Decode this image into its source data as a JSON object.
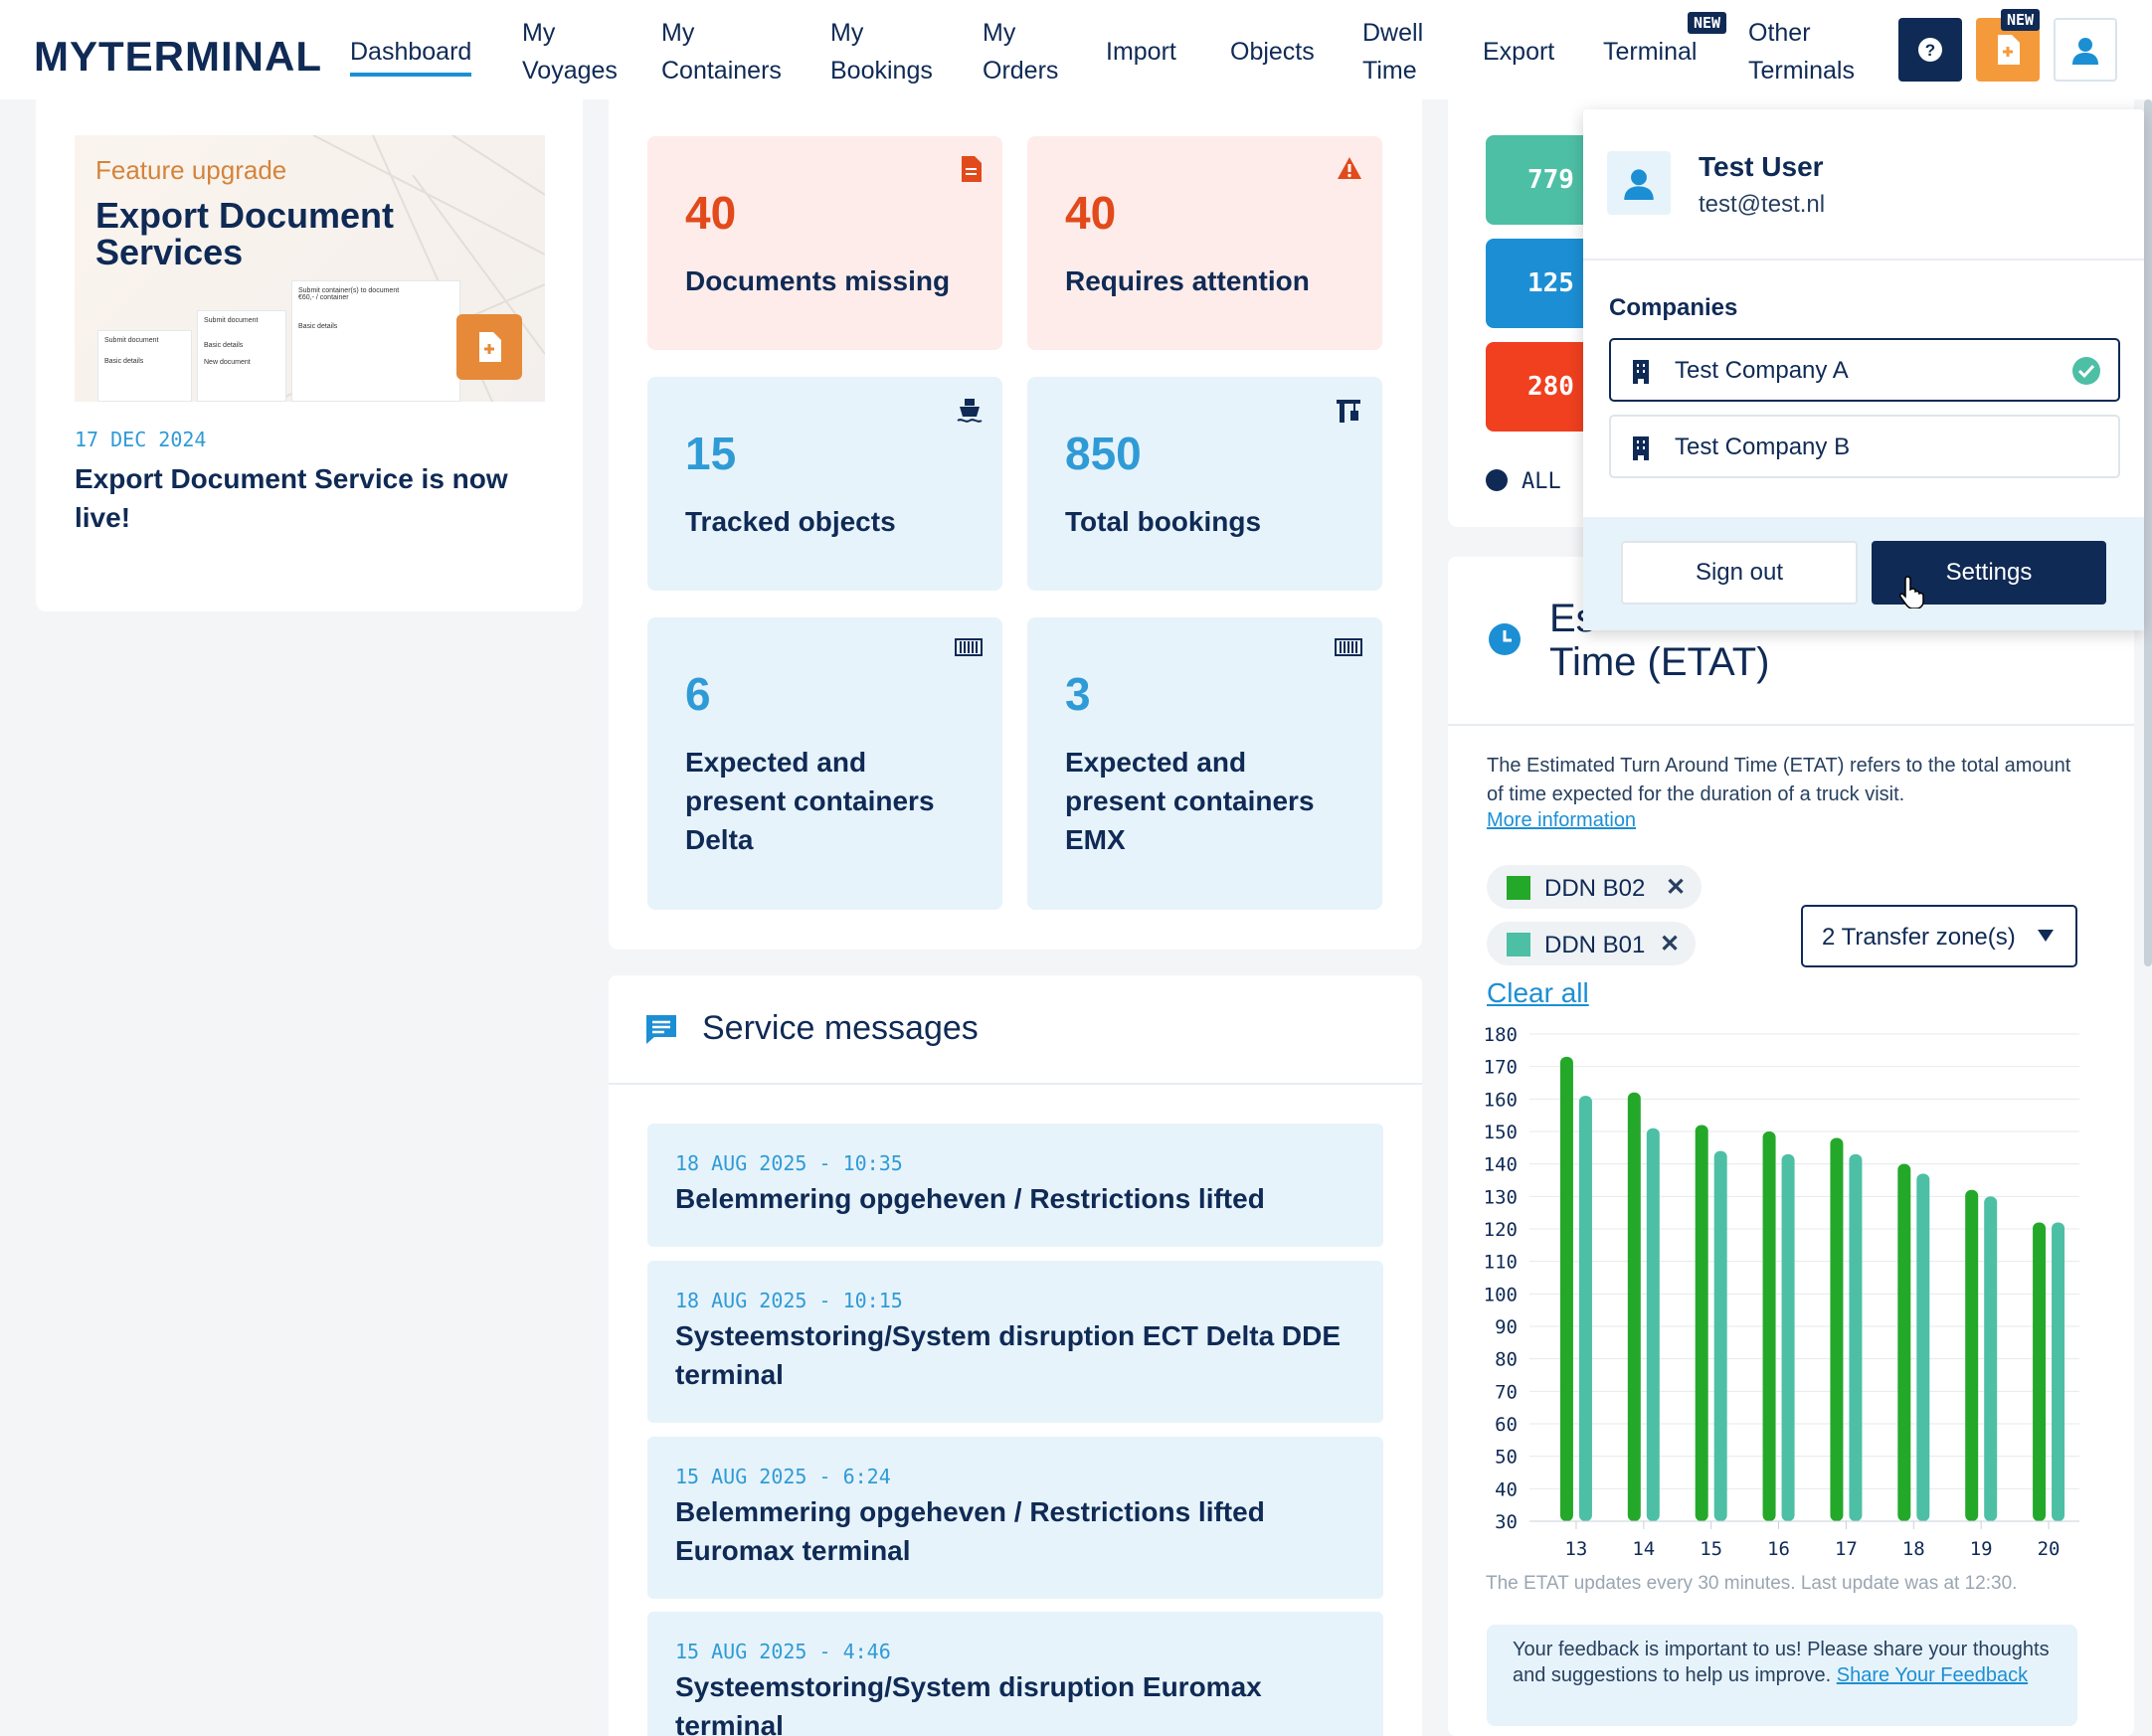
{
  "header": {
    "logo": "MYTERMINAL",
    "nav": [
      {
        "id": "dashboard",
        "lines": [
          "Dashboard"
        ]
      },
      {
        "id": "voyages",
        "lines": [
          "My",
          "Voyages"
        ]
      },
      {
        "id": "containers",
        "lines": [
          "My",
          "Containers"
        ]
      },
      {
        "id": "bookings",
        "lines": [
          "My",
          "Bookings"
        ]
      },
      {
        "id": "orders",
        "lines": [
          "My",
          "Orders"
        ]
      },
      {
        "id": "import",
        "lines": [
          "Import"
        ]
      },
      {
        "id": "objects",
        "lines": [
          "Objects"
        ]
      },
      {
        "id": "dwell",
        "lines": [
          "Dwell",
          "Time"
        ]
      },
      {
        "id": "export",
        "lines": [
          "Export"
        ]
      },
      {
        "id": "terminal",
        "lines": [
          "Terminal"
        ]
      },
      {
        "id": "other",
        "lines": [
          "Other",
          "Terminals"
        ]
      }
    ],
    "new_badge": "NEW"
  },
  "feature": {
    "tag": "Feature upgrade",
    "title_line1": "Export Document",
    "title_line2": "Services",
    "mock_title": "Submit container(s) to document",
    "mock_sub": "€60,- / container",
    "mock_basic": "Basic details",
    "mock_submit": "Submit document",
    "mock_new": "New document",
    "date": "17 DEC 2024",
    "headline": "Export Document Service is now live!"
  },
  "stats": [
    {
      "value": "40",
      "label": "Documents missing",
      "style": "pink",
      "icon": "document-icon"
    },
    {
      "value": "40",
      "label": "Requires attention",
      "style": "pink",
      "icon": "warning-icon"
    },
    {
      "value": "15",
      "label": "Tracked objects",
      "style": "blue",
      "icon": "ship-icon"
    },
    {
      "value": "850",
      "label": "Total bookings",
      "style": "blue",
      "icon": "crane-icon"
    },
    {
      "value": "6",
      "label": "Expected and present containers Delta",
      "style": "blue",
      "icon": "container-icon"
    },
    {
      "value": "3",
      "label": "Expected and present containers EMX",
      "style": "blue",
      "icon": "container-icon"
    }
  ],
  "service": {
    "title": "Service messages",
    "messages": [
      {
        "date": "18 AUG 2025 - 10:35",
        "title": "Belemmering opgeheven / Restrictions lifted"
      },
      {
        "date": "18 AUG 2025 - 10:15",
        "title": "Systeemstoring/System disruption ECT Delta DDE terminal"
      },
      {
        "date": "15 AUG 2025 - 6:24",
        "title": "Belemmering opgeheven / Restrictions lifted Euromax terminal"
      },
      {
        "date": "15 AUG 2025 - 4:46",
        "title": "Systeemstoring/System disruption Euromax terminal"
      }
    ]
  },
  "right": {
    "bars": [
      "779",
      "125",
      "280"
    ],
    "bar_colors": [
      "#4dbfa5",
      "#1c8fd4",
      "#f0401f"
    ],
    "legend_all": "ALL",
    "etat_title_partial": "Es",
    "etat_title_line2": "Time (ETAT)",
    "etat_desc": "The Estimated Turn Around Time (ETAT) refers to the total amount of time expected for the duration of a truck visit.",
    "more_info": "More information",
    "chips": [
      {
        "label": "DDN B02",
        "color": "#24a82a"
      },
      {
        "label": "DDN B01",
        "color": "#4dbfa5"
      }
    ],
    "zones_select": "2 Transfer zone(s)",
    "clear_all": "Clear all",
    "update_note": "The ETAT updates every 30 minutes. Last update was at 12:30.",
    "feedback_text": "Your feedback is important to us! Please share your thoughts and suggestions to help us improve.",
    "feedback_link": "Share Your Feedback"
  },
  "chart_data": {
    "type": "bar",
    "categories": [
      "13",
      "14",
      "15",
      "16",
      "17",
      "18",
      "19",
      "20"
    ],
    "series": [
      {
        "name": "DDN B02",
        "color": "#24a82a",
        "values": [
          173,
          162,
          152,
          150,
          148,
          140,
          132,
          122
        ]
      },
      {
        "name": "DDN B01",
        "color": "#4dbfa5",
        "values": [
          161,
          151,
          144,
          143,
          143,
          137,
          130,
          122
        ]
      }
    ],
    "ylim": [
      30,
      180
    ],
    "yticks": [
      "180",
      "170",
      "160",
      "150",
      "140",
      "130",
      "120",
      "110",
      "100",
      "90",
      "80",
      "70",
      "60",
      "50",
      "40",
      "30"
    ],
    "grid": true
  },
  "user_menu": {
    "name": "Test User",
    "email": "test@test.nl",
    "companies_label": "Companies",
    "companies": [
      {
        "name": "Test Company A",
        "selected": true
      },
      {
        "name": "Test Company B",
        "selected": false
      }
    ],
    "sign_out": "Sign out",
    "settings": "Settings"
  }
}
